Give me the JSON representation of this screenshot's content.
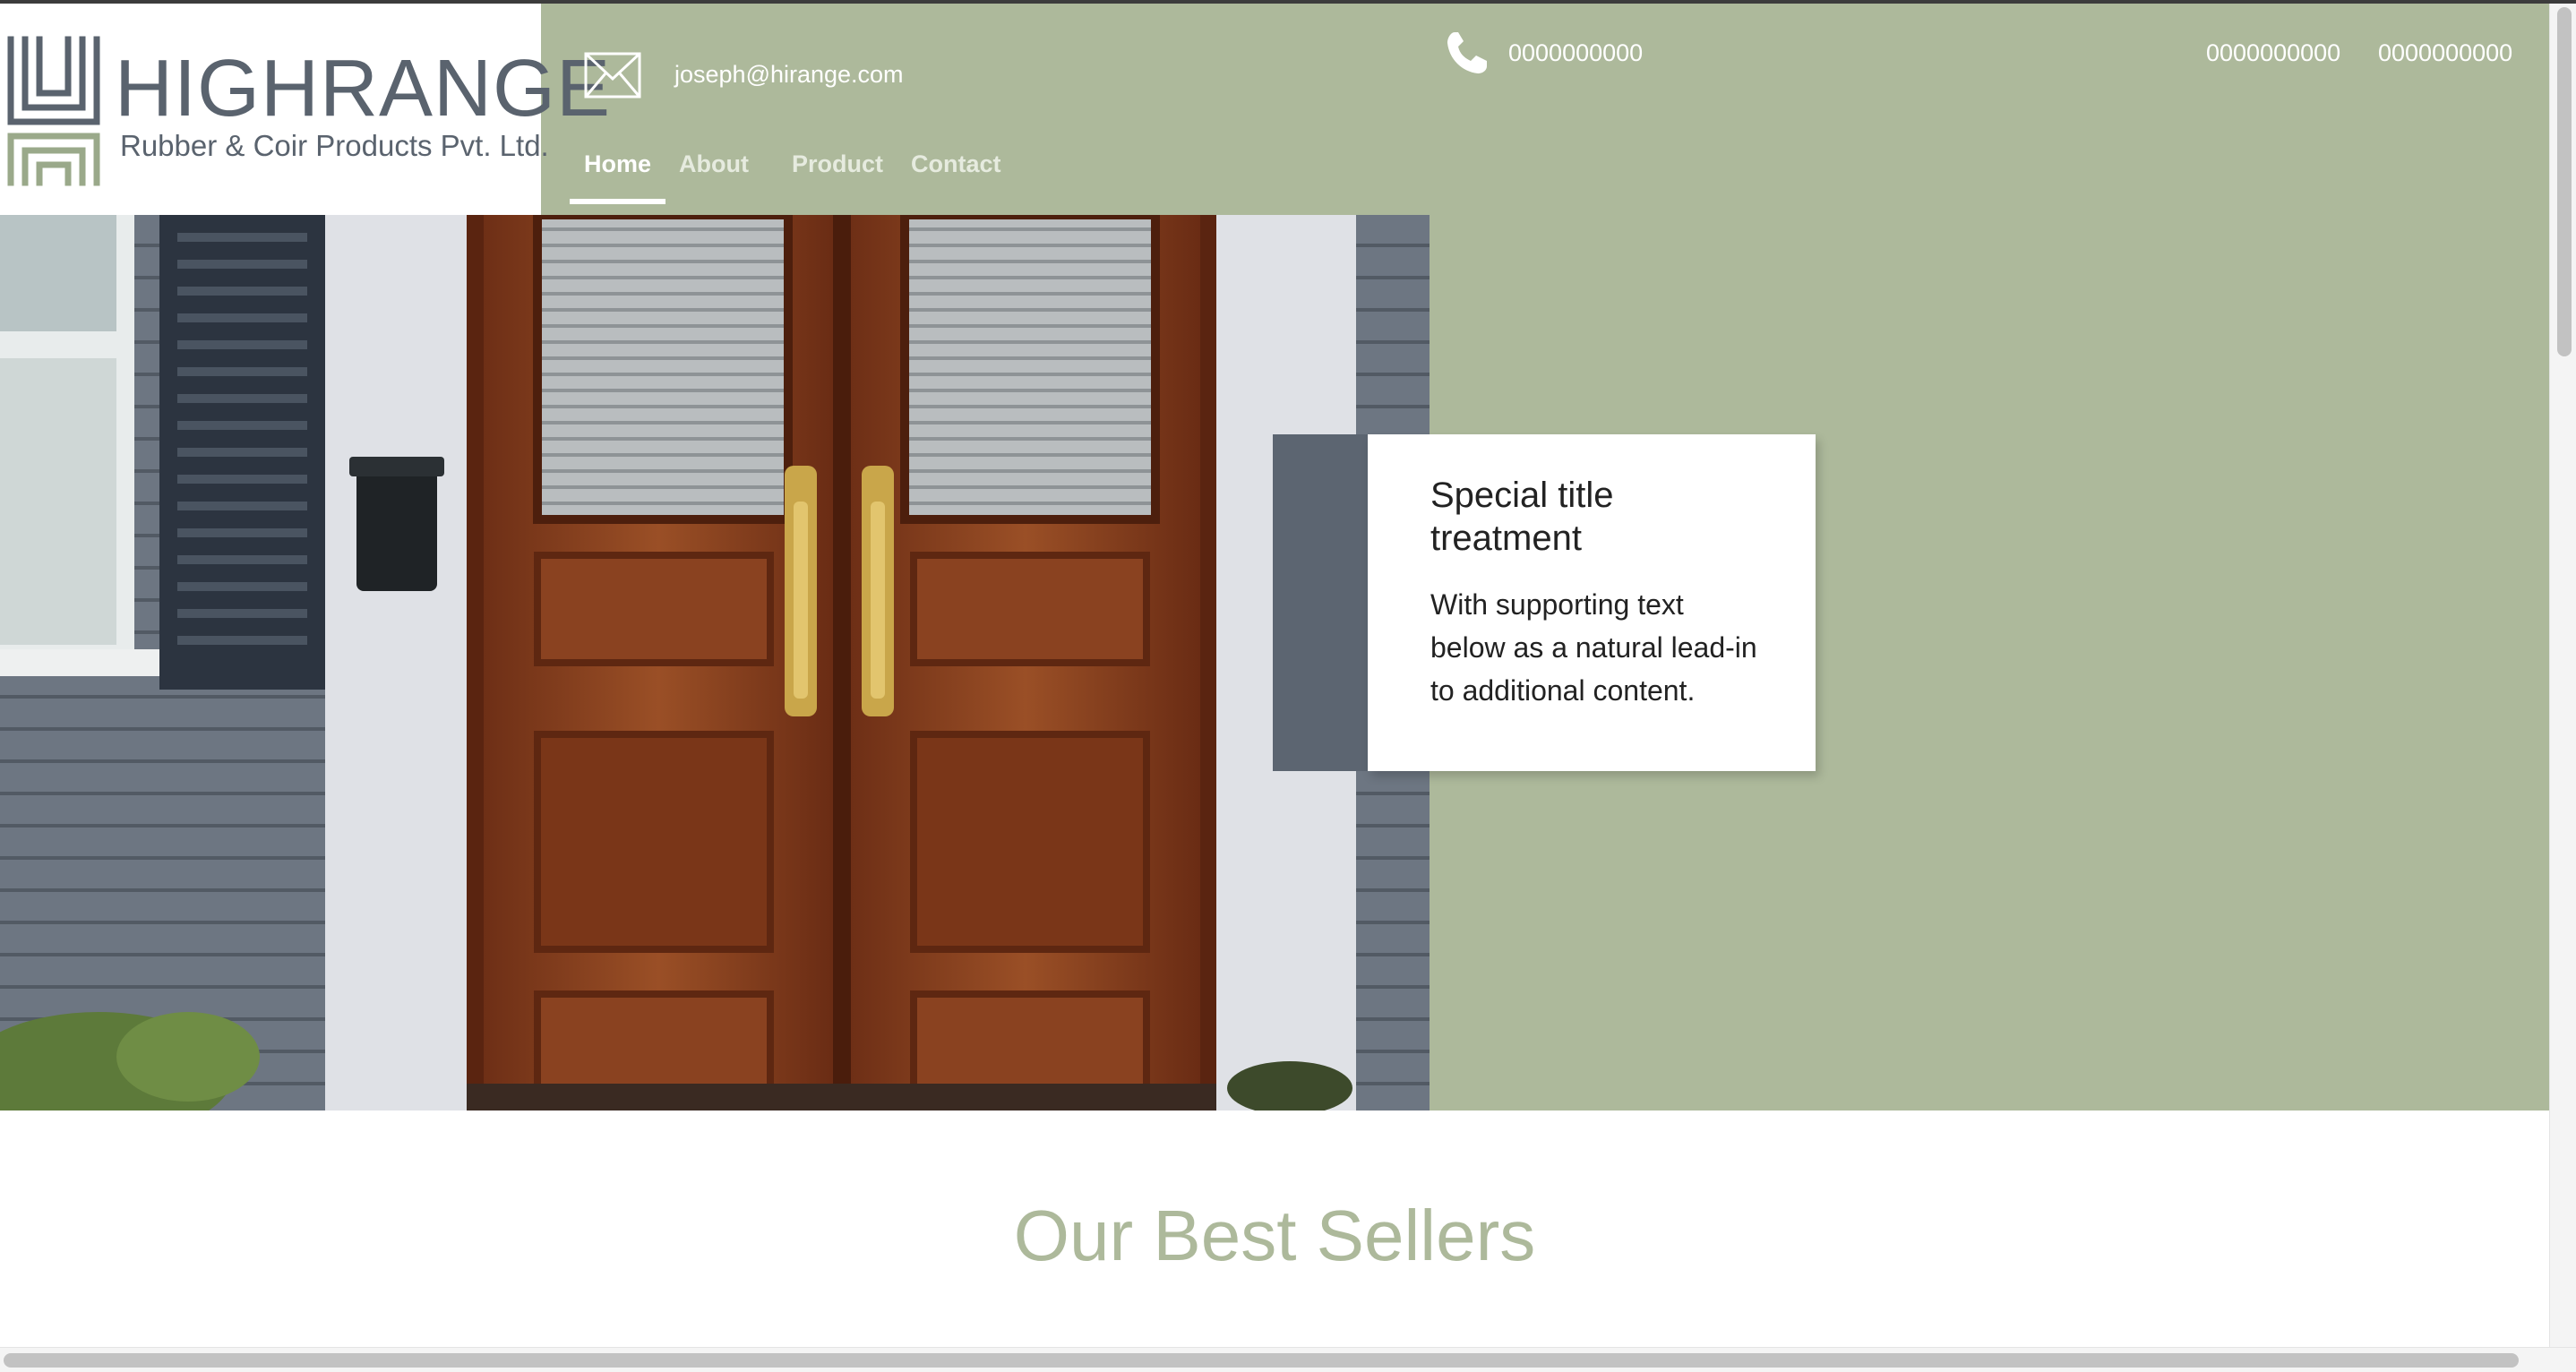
{
  "brand": {
    "name": "HIGHRANGE",
    "tagline": "Rubber & Coir Products Pvt. Ltd."
  },
  "contact": {
    "email": "joseph@hirange.com",
    "phones": [
      "0000000000",
      "0000000000",
      "0000000000"
    ]
  },
  "nav": {
    "items": [
      {
        "label": "Home",
        "active": true
      },
      {
        "label": "About",
        "active": false
      },
      {
        "label": "Product",
        "active": false
      },
      {
        "label": "Contact",
        "active": false
      }
    ]
  },
  "hero": {
    "card_title": "Special title treatment",
    "card_text": "With supporting text below as a natural lead-in to additional content."
  },
  "section": {
    "title": "Our Best Sellers"
  },
  "icons": {
    "mail": "mail-icon",
    "phone": "phone-icon",
    "logo": "logo-mark-icon"
  },
  "colors": {
    "accent": "#adb99b",
    "logo_text": "#5a636e",
    "card_accent": "#5c6571"
  }
}
